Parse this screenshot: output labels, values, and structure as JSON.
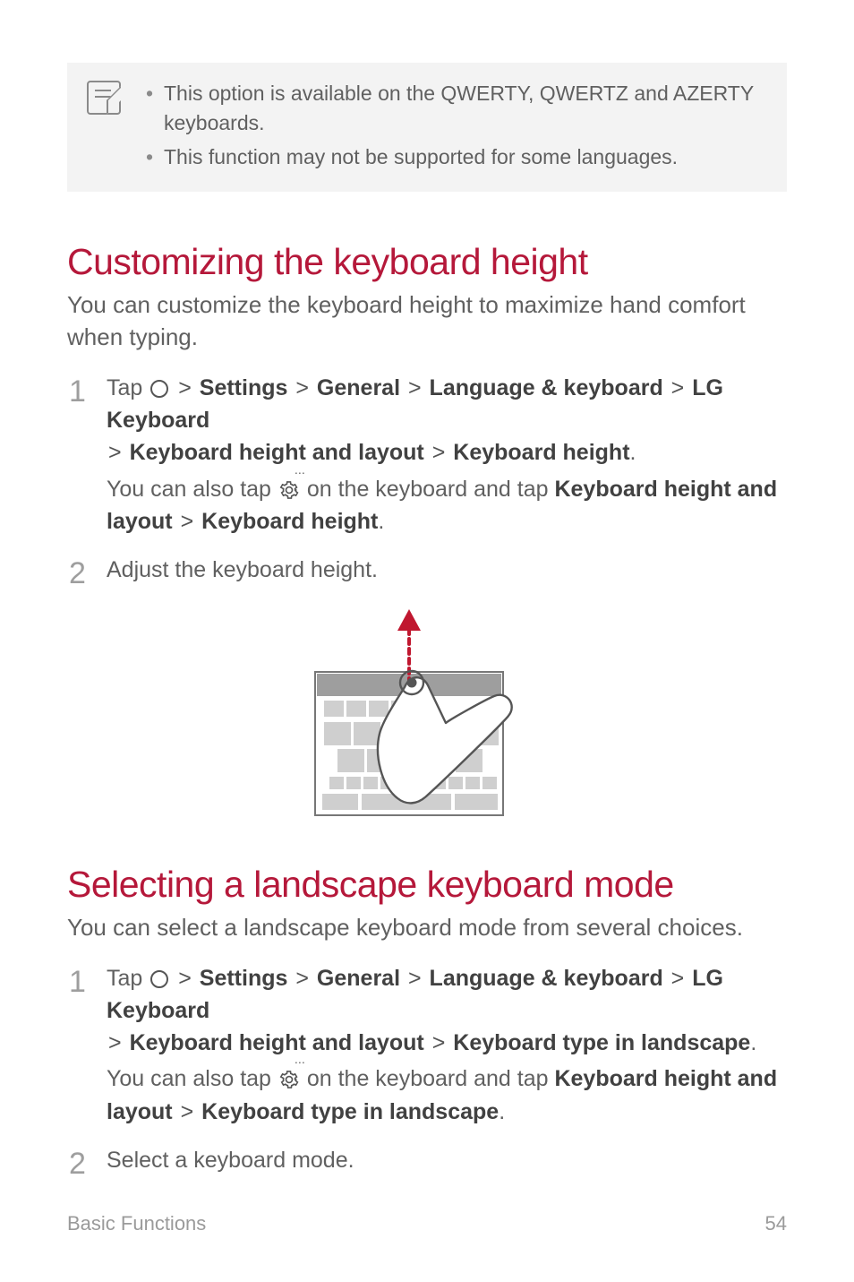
{
  "note": {
    "items": [
      "This option is available on the QWERTY, QWERTZ and AZERTY keyboards.",
      "This function may not be supported for some languages."
    ]
  },
  "nav": {
    "settings": "Settings",
    "general": "General",
    "lang_kbd": "Language & keyboard",
    "lg_kbd": "LG Keyboard",
    "kbd_height_layout": "Keyboard height and layout",
    "kbd_height": "Keyboard height",
    "kbd_type_landscape": "Keyboard type in landscape"
  },
  "strings": {
    "tap": "Tap ",
    "also_tap_prefix": "You can also tap ",
    "also_tap_mid": " on the keyboard and tap ",
    "layout_prefix": "layout"
  },
  "section1": {
    "heading": "Customizing the keyboard height",
    "intro": "You can customize the keyboard height to maximize hand comfort when typing.",
    "step2": "Adjust the keyboard height."
  },
  "section2": {
    "heading": "Selecting a landscape keyboard mode",
    "intro": "You can select a landscape keyboard mode from several choices.",
    "step2": "Select a keyboard mode."
  },
  "footer": {
    "section": "Basic Functions",
    "page": "54"
  }
}
